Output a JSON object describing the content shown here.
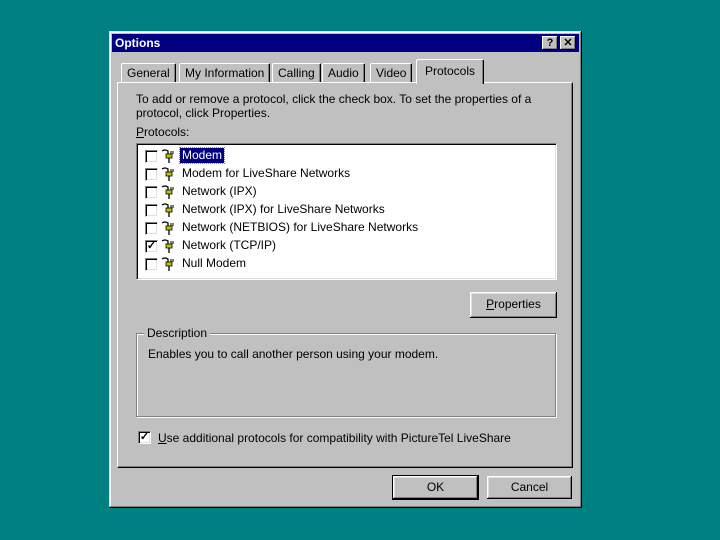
{
  "window": {
    "title": "Options",
    "help_button": "?",
    "close_button": "✕"
  },
  "tabs": [
    {
      "label": "General"
    },
    {
      "label": "My Information"
    },
    {
      "label": "Calling"
    },
    {
      "label": "Audio"
    },
    {
      "label": "Video"
    },
    {
      "label": "Protocols",
      "active": true
    }
  ],
  "instructions": "To add or remove a protocol, click the check box. To set the properties of a protocol, click Properties.",
  "protocols_label": {
    "accel": "P",
    "rest": "rotocols:"
  },
  "protocols": [
    {
      "label": "Modem",
      "checked": false,
      "selected": true
    },
    {
      "label": "Modem for LiveShare Networks",
      "checked": false
    },
    {
      "label": "Network (IPX)",
      "checked": false
    },
    {
      "label": "Network (IPX) for LiveShare Networks",
      "checked": false
    },
    {
      "label": "Network (NETBIOS) for LiveShare Networks",
      "checked": false
    },
    {
      "label": "Network (TCP/IP)",
      "checked": true
    },
    {
      "label": "Null Modem",
      "checked": false
    }
  ],
  "properties_button": {
    "accel": "P",
    "rest": "roperties"
  },
  "description": {
    "legend": "Description",
    "text": "Enables you to call another person using your modem."
  },
  "compat_checkbox": {
    "checked": true,
    "accel": "U",
    "rest": "se additional protocols for compatibility with PictureTel LiveShare"
  },
  "buttons": {
    "ok": "OK",
    "cancel": "Cancel"
  },
  "colors": {
    "desktop": "#008080",
    "titlebar": "#000080",
    "face": "#c0c0c0",
    "selection": "#000080"
  },
  "icons": {
    "protocol": "network-plug-icon",
    "help": "help-icon",
    "close": "close-icon",
    "check": "checkmark-icon"
  }
}
